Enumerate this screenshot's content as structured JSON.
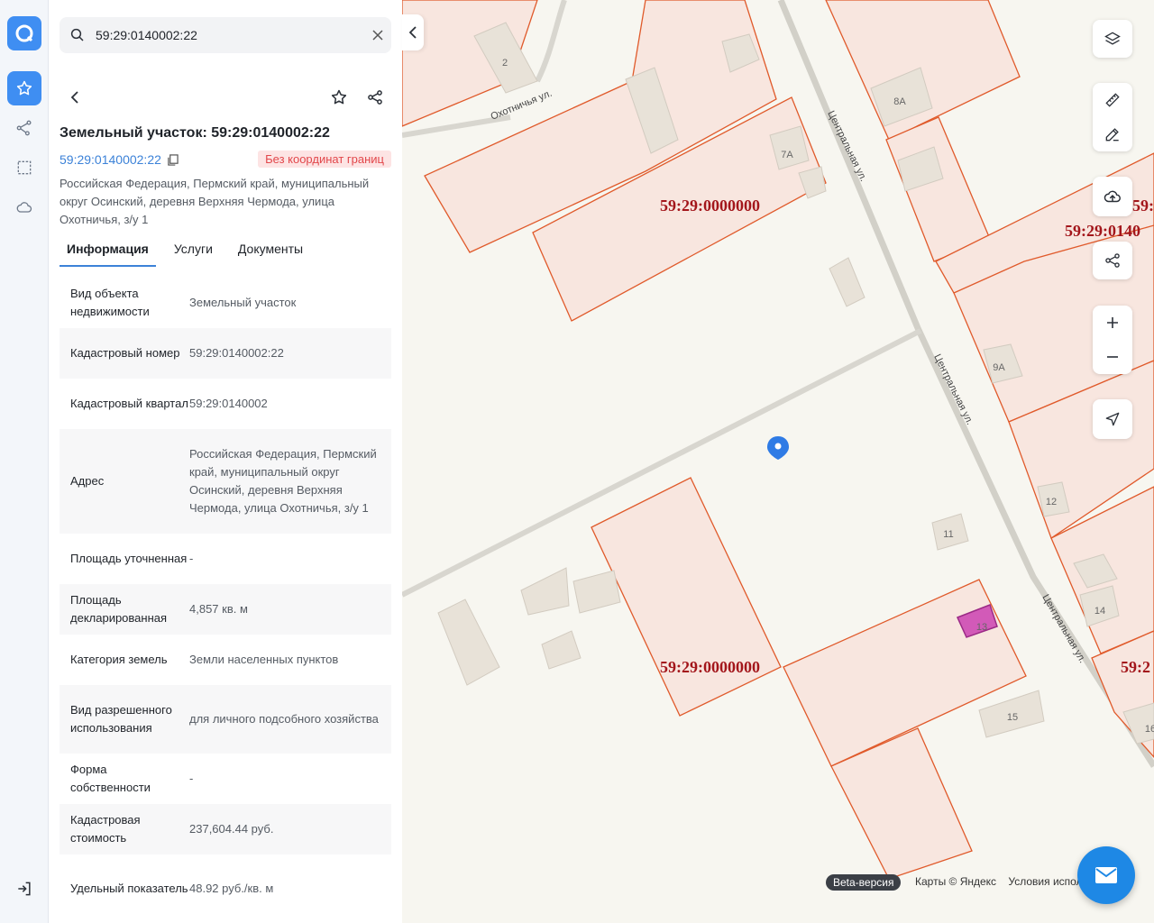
{
  "search": {
    "value": "59:29:0140002:22"
  },
  "header": {
    "title": "Земельный участок: 59:29:0140002:22",
    "cad_link": "59:29:0140002:22",
    "badge": "Без координат границ",
    "address": "Российская Федерация, Пермский край, муниципальный округ Осинский, деревня Верхняя Чермода, улица Охотничья, з/у 1"
  },
  "tabs": [
    {
      "label": "Информация"
    },
    {
      "label": "Услуги"
    },
    {
      "label": "Документы"
    }
  ],
  "info": [
    {
      "k": "Вид объекта недвижимости",
      "v": "Земельный участок"
    },
    {
      "k": "Кадастровый номер",
      "v": "59:29:0140002:22"
    },
    {
      "k": "Кадастровый квартал",
      "v": "59:29:0140002"
    },
    {
      "k": "Адрес",
      "v": "Российская Федерация, Пермский край, муниципальный округ Осинский, деревня Верхняя Чермода, улица Охотничья, з/у 1"
    },
    {
      "k": "Площадь уточненная",
      "v": "-"
    },
    {
      "k": "Площадь декларированная",
      "v": "4,857 кв. м"
    },
    {
      "k": "Категория земель",
      "v": "Земли населенных пунктов"
    },
    {
      "k": "Вид разрешенного использования",
      "v": "для личного подсобного хозяйства"
    },
    {
      "k": "Форма собственности",
      "v": "-"
    },
    {
      "k": "Кадастровая стоимость",
      "v": "237,604.44 руб."
    },
    {
      "k": "Удельный показатель",
      "v": "48.92 руб./кв. м"
    }
  ],
  "map": {
    "streets": [
      "Охотничья ул.",
      "Центральная ул.",
      "Центральная ул.",
      "Центральная ул."
    ],
    "cad_labels": [
      "59:29:0000000",
      "59:29:0000000",
      "59:29:0140",
      "59:2",
      "59:2"
    ],
    "houses": [
      "2",
      "8А",
      "7А",
      "9А",
      "12",
      "11",
      "13",
      "14",
      "15",
      "16"
    ],
    "beta": "Beta-версия",
    "attribution": [
      "Карты © Яндекс",
      "Условия испол"
    ]
  },
  "colors": {
    "accent": "#3f8ef2",
    "parcel_stroke": "#e05a2b",
    "parcel_fill": "#f8e6df",
    "label": "#a3161b"
  }
}
